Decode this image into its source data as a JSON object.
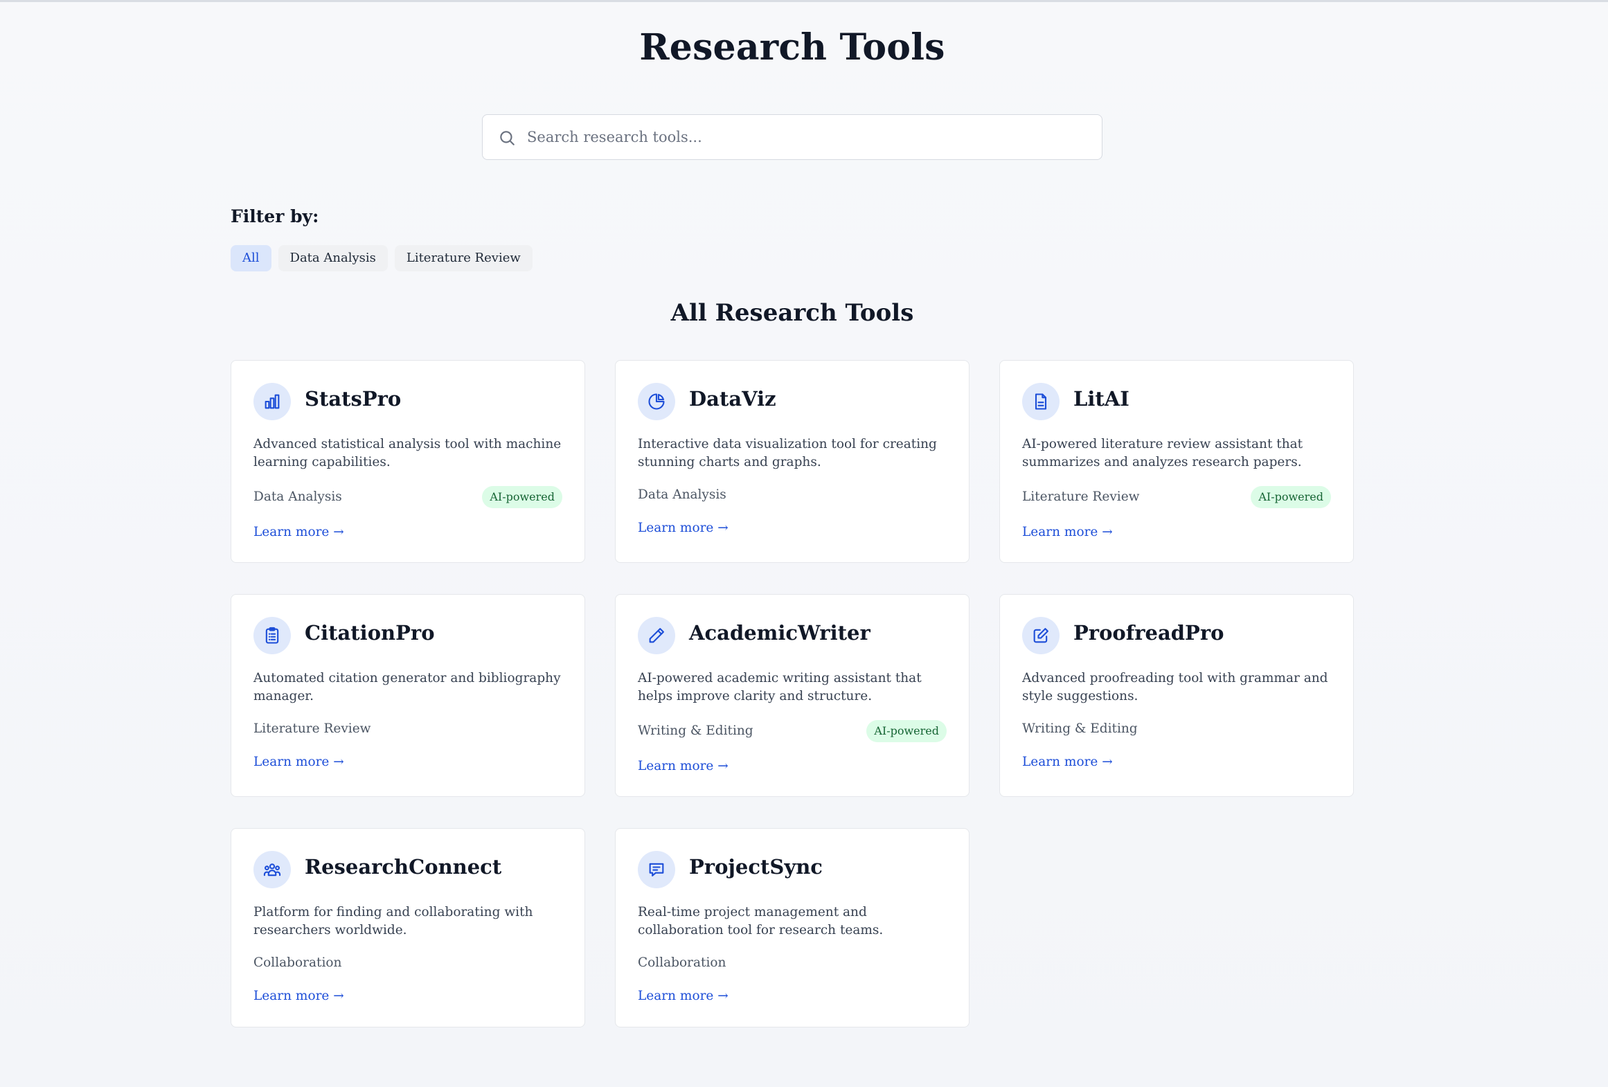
{
  "page": {
    "title": "Research Tools",
    "section_title": "All Research Tools"
  },
  "search": {
    "placeholder": "Search research tools...",
    "value": ""
  },
  "filters": {
    "heading": "Filter by:",
    "options": [
      "All",
      "Data Analysis",
      "Literature Review"
    ],
    "active": "All"
  },
  "colors": {
    "accent": "#1d4ed8",
    "icon_bg": "#e0e9fb",
    "badge_bg": "#dcfce7",
    "badge_text": "#166534"
  },
  "tools": [
    {
      "name": "StatsPro",
      "icon": "bar-chart-icon",
      "description": "Advanced statistical analysis tool with machine learning capabilities.",
      "category": "Data Analysis",
      "badge": "AI-powered",
      "link": "Learn more →"
    },
    {
      "name": "DataViz",
      "icon": "pie-chart-icon",
      "description": "Interactive data visualization tool for creating stunning charts and graphs.",
      "category": "Data Analysis",
      "badge": "",
      "link": "Learn more →"
    },
    {
      "name": "LitAI",
      "icon": "document-icon",
      "description": "AI-powered literature review assistant that summarizes and analyzes research papers.",
      "category": "Literature Review",
      "badge": "AI-powered",
      "link": "Learn more →"
    },
    {
      "name": "CitationPro",
      "icon": "clipboard-list-icon",
      "description": "Automated citation generator and bibliography manager.",
      "category": "Literature Review",
      "badge": "",
      "link": "Learn more →"
    },
    {
      "name": "AcademicWriter",
      "icon": "pencil-icon",
      "description": "AI-powered academic writing assistant that helps improve clarity and structure.",
      "category": "Writing & Editing",
      "badge": "AI-powered",
      "link": "Learn more →"
    },
    {
      "name": "ProofreadPro",
      "icon": "edit-square-icon",
      "description": "Advanced proofreading tool with grammar and style suggestions.",
      "category": "Writing & Editing",
      "badge": "",
      "link": "Learn more →"
    },
    {
      "name": "ResearchConnect",
      "icon": "users-group-icon",
      "description": "Platform for finding and collaborating with researchers worldwide.",
      "category": "Collaboration",
      "badge": "",
      "link": "Learn more →"
    },
    {
      "name": "ProjectSync",
      "icon": "chat-message-icon",
      "description": "Real-time project management and collaboration tool for research teams.",
      "category": "Collaboration",
      "badge": "",
      "link": "Learn more →"
    }
  ]
}
